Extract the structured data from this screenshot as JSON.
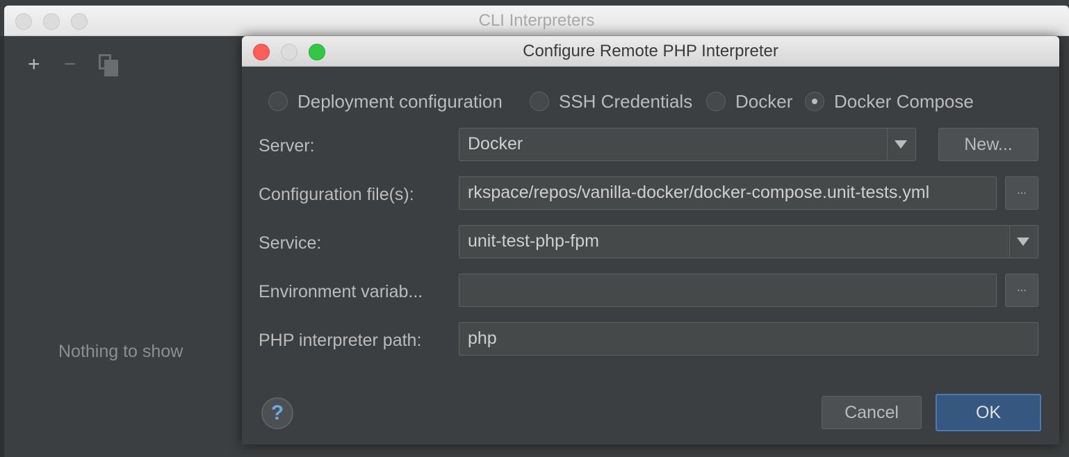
{
  "outer_window": {
    "title": "CLI Interpreters",
    "toolbar": {
      "add_icon": "plus-icon",
      "remove_icon": "minus-icon",
      "copy_icon": "copy-icon"
    },
    "empty_text": "Nothing to show"
  },
  "dialog": {
    "title": "Configure Remote PHP Interpreter",
    "radios": [
      {
        "label": "Deployment configuration",
        "checked": false
      },
      {
        "label": "SSH Credentials",
        "checked": false
      },
      {
        "label": "Docker",
        "checked": false
      },
      {
        "label": "Docker Compose",
        "checked": true
      }
    ],
    "server": {
      "label": "Server:",
      "value": "Docker",
      "new_button": "New..."
    },
    "config_files": {
      "label": "Configuration file(s):",
      "value": "rkspace/repos/vanilla-docker/docker-compose.unit-tests.yml",
      "browse": "..."
    },
    "service": {
      "label": "Service:",
      "value": "unit-test-php-fpm"
    },
    "env_vars": {
      "label": "Environment variab...",
      "value": "",
      "browse": "..."
    },
    "php_path": {
      "label": "PHP interpreter path:",
      "value": "php"
    },
    "help": "?",
    "cancel_button": "Cancel",
    "ok_button": "OK"
  }
}
